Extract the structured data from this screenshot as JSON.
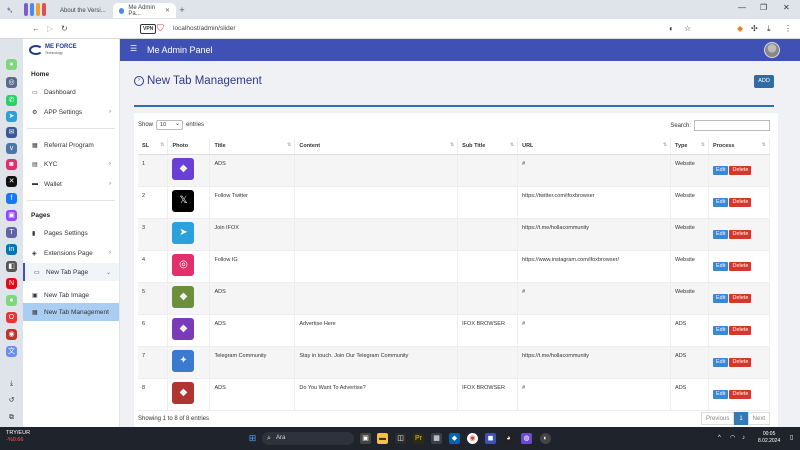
{
  "browser": {
    "tabs": [
      {
        "label": "About the Versi..."
      },
      {
        "label": "Me Admin Pa..."
      }
    ],
    "url": "localhost/admin/slider",
    "vpn_label": "VPN"
  },
  "sidebar": {
    "logo_line1": "ME FORCE",
    "logo_line2": "Technology",
    "section_home": "Home",
    "items_home": [
      {
        "label": "Dashboard"
      },
      {
        "label": "APP Settings"
      }
    ],
    "items_mid": [
      {
        "label": "Referral Program"
      },
      {
        "label": "KYC"
      },
      {
        "label": "Wallet"
      }
    ],
    "section_pages": "Pages",
    "items_pages": [
      {
        "label": "Pages Settings"
      },
      {
        "label": "Extensions Page"
      },
      {
        "label": "New Tab Page"
      }
    ],
    "subitems": [
      {
        "label": "New Tab Image"
      },
      {
        "label": "New Tab Management"
      }
    ]
  },
  "header": {
    "menu_icon": "☰",
    "panel_title": "Me Admin Panel"
  },
  "page": {
    "title": "New Tab Management",
    "add_label": "ADD"
  },
  "table_controls": {
    "show_label": "Show",
    "entries_value": "10",
    "entries_label": "entries",
    "search_label": "Search:"
  },
  "table": {
    "headers": [
      "SL",
      "Photo",
      "Title",
      "Content",
      "Sub Title",
      "URL",
      "Type",
      "Process"
    ],
    "edit_label": "Edit",
    "delete_label": "Delete",
    "rows": [
      {
        "sl": "1",
        "title": "ADS",
        "content": "",
        "subtitle": "",
        "url": "#",
        "type": "Website",
        "photo_color": "#6a3fd6",
        "photo_icon": "app-store-icon"
      },
      {
        "sl": "2",
        "title": "Follow Twitter",
        "content": "",
        "subtitle": "",
        "url": "https://twitter.com/ifoxbrowser",
        "type": "Website",
        "photo_color": "#000000",
        "photo_icon": "x-logo-icon"
      },
      {
        "sl": "3",
        "title": "Join IFOX",
        "content": "",
        "subtitle": "",
        "url": "https://t.me/hollacommunity",
        "type": "Website",
        "photo_color": "#2aa1da",
        "photo_icon": "telegram-icon"
      },
      {
        "sl": "4",
        "title": "Follow IG",
        "content": "",
        "subtitle": "",
        "url": "https://www.instagram.com/ifoxbrowser/",
        "type": "Website",
        "photo_color": "#e1306c",
        "photo_icon": "instagram-icon"
      },
      {
        "sl": "5",
        "title": "ADS",
        "content": "",
        "subtitle": "",
        "url": "#",
        "type": "Website",
        "photo_color": "#6b8f3a",
        "photo_icon": "game-art-icon"
      },
      {
        "sl": "6",
        "title": "ADS",
        "content": "Advertise Here",
        "subtitle": "IFOX BROWSER",
        "url": "#",
        "type": "ADS",
        "photo_color": "#7a3bb8",
        "photo_icon": "game-art-icon"
      },
      {
        "sl": "7",
        "title": "Telegram Community",
        "content": "Stay in touch. Join Our Telegram Community",
        "subtitle": "",
        "url": "https://t.me/hollacommunity",
        "type": "ADS",
        "photo_color": "#3a7bd0",
        "photo_icon": "telegram-art-icon"
      },
      {
        "sl": "8",
        "title": "ADS",
        "content": "Do You Want To Advertise?",
        "subtitle": "IFOX BROWSER",
        "url": "#",
        "type": "ADS",
        "photo_color": "#b0342f",
        "photo_icon": "game-art-icon"
      }
    ]
  },
  "footer": {
    "info": "Showing 1 to 8 of 8 entries",
    "previous": "Previous",
    "page": "1",
    "next": "Next"
  },
  "taskbar": {
    "ticker": "TRY/EUR",
    "ticker_change": "-%0.66",
    "search_placeholder": "Ara",
    "time": "00:05",
    "date": "8.02.2024"
  },
  "colors": {
    "accent": "#3f51b5",
    "title": "#2d3a8c",
    "add_button": "#2e6da4",
    "edit": "#3c86d8",
    "delete": "#d9362b",
    "active_item": "#a9cdf3"
  }
}
